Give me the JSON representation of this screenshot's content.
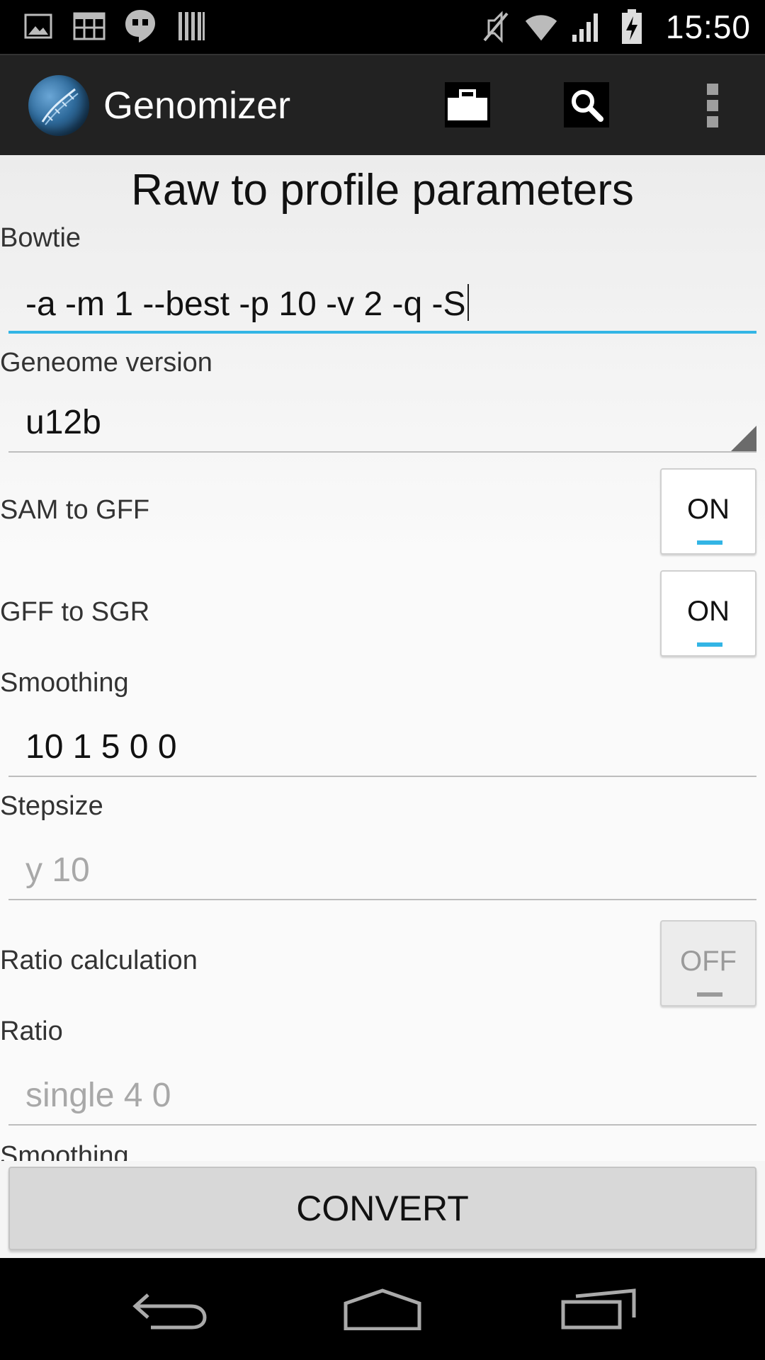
{
  "status_bar": {
    "time": "15:50",
    "left_icons": [
      "image-icon",
      "grid-icon",
      "hangouts-icon",
      "barcode-icon"
    ],
    "right_icons": [
      "muted-icon",
      "wifi-icon",
      "signal-icon",
      "battery-charging-icon"
    ]
  },
  "action_bar": {
    "title": "Genomizer",
    "actions": [
      "briefcase-icon",
      "search-icon",
      "overflow-menu-icon"
    ]
  },
  "form": {
    "title": "Raw to profile parameters",
    "bowtie_label": "Bowtie",
    "bowtie_value": "-a -m 1 --best -p 10 -v 2 -q -S",
    "genome_label": "Geneome version",
    "genome_value": "u12b",
    "sam_to_gff_label": "SAM to GFF",
    "sam_to_gff_state": "ON",
    "gff_to_sgr_label": "GFF to SGR",
    "gff_to_sgr_state": "ON",
    "smoothing_label": "Smoothing",
    "smoothing_value": "10 1 5 0 0",
    "stepsize_label": "Stepsize",
    "stepsize_placeholder": "y 10",
    "ratio_calc_label": "Ratio calculation",
    "ratio_calc_state": "OFF",
    "ratio_label": "Ratio",
    "ratio_placeholder": "single 4 0",
    "smoothing2_label": "Smoothing"
  },
  "convert_label": "CONVERT",
  "colors": {
    "accent": "#33b5e5",
    "action_bar": "#222222",
    "background": "#fafafa"
  }
}
